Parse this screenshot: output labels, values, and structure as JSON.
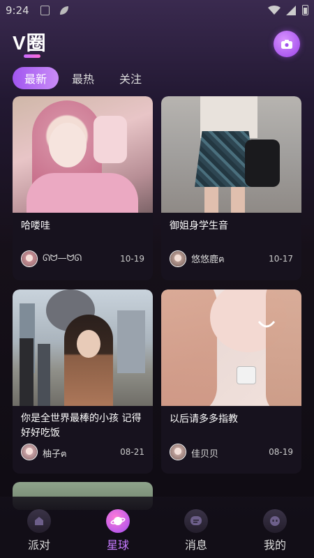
{
  "status_bar": {
    "time": "9:24"
  },
  "header": {
    "logo_text": "V圈"
  },
  "tabs": [
    {
      "label": "最新",
      "active": true
    },
    {
      "label": "最热",
      "active": false
    },
    {
      "label": "关注",
      "active": false
    }
  ],
  "posts": [
    {
      "title": "哈喽哇",
      "user": "ᘏᗢ—ᗢᘏ",
      "date": "10-19"
    },
    {
      "title": "御姐身学生音",
      "user": "悠悠鹿ฅ",
      "date": "10-17"
    },
    {
      "title": "你是全世界最棒的小孩 记得好好吃饭",
      "user": "柚子ฅ",
      "date": "08-21"
    },
    {
      "title": "以后请多多指教",
      "user": "佳贝贝",
      "date": "08-19"
    }
  ],
  "nav": [
    {
      "label": "派对",
      "icon": "house-icon",
      "active": false
    },
    {
      "label": "星球",
      "icon": "planet-icon",
      "active": true
    },
    {
      "label": "消息",
      "icon": "message-icon",
      "active": false
    },
    {
      "label": "我的",
      "icon": "profile-icon",
      "active": false
    }
  ],
  "colors": {
    "accent": "#a156f0",
    "background": "#0e0b12"
  }
}
